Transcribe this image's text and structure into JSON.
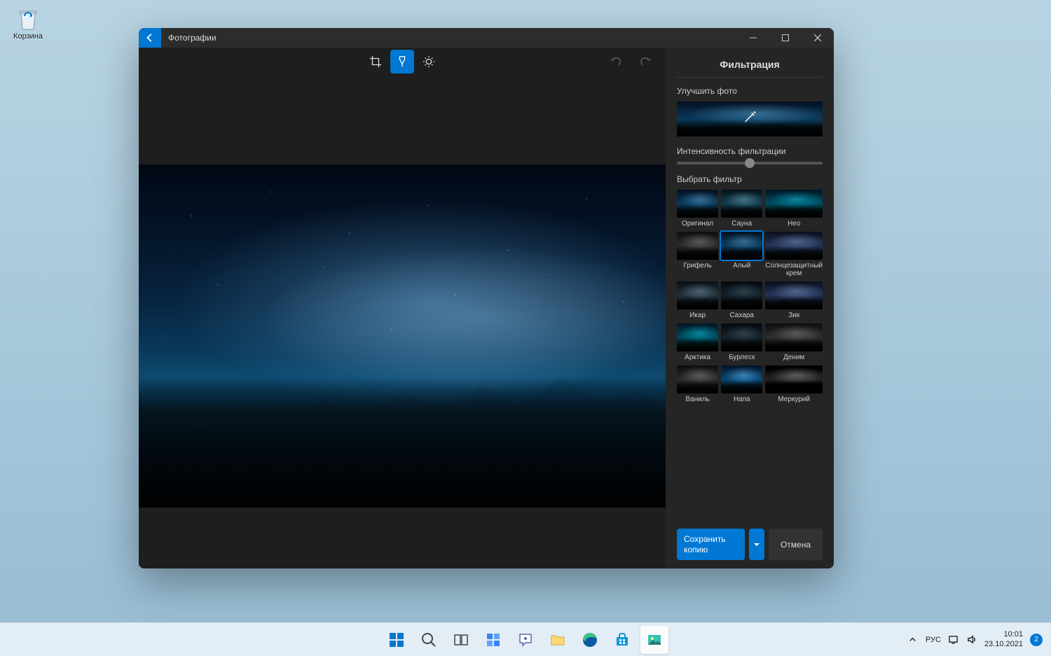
{
  "desktop": {
    "recycle_bin": "Корзина"
  },
  "app": {
    "title": "Фотографии",
    "panel": {
      "title": "Фильтрация",
      "enhance_label": "Улучшить фото",
      "intensity_label": "Интенсивность фильтрации",
      "intensity_value": 50,
      "choose_filter_label": "Выбрать фильтр",
      "filters": [
        {
          "label": "Оригинал",
          "tone": ""
        },
        {
          "label": "Сауна",
          "tone": "f-warm"
        },
        {
          "label": "Нео",
          "tone": "f-blue"
        },
        {
          "label": "Грифель",
          "tone": "f-gray"
        },
        {
          "label": "Алый",
          "tone": ""
        },
        {
          "label": "Солнцезащитный крем",
          "tone": "f-teal"
        },
        {
          "label": "Икар",
          "tone": "f-desat"
        },
        {
          "label": "Сахара",
          "tone": "f-dark"
        },
        {
          "label": "Зик",
          "tone": "f-teal"
        },
        {
          "label": "Арктика",
          "tone": "f-blue"
        },
        {
          "label": "Бурлеск",
          "tone": "f-dark"
        },
        {
          "label": "Деним",
          "tone": "f-gray"
        },
        {
          "label": "Ваниль",
          "tone": "f-gray"
        },
        {
          "label": "Напа",
          "tone": "f-bright"
        },
        {
          "label": "Меркурий",
          "tone": "f-bw"
        }
      ],
      "selected_filter_index": 4,
      "save_label": "Сохранить копию",
      "cancel_label": "Отмена"
    }
  },
  "taskbar": {
    "lang": "РУС",
    "time": "10:01",
    "date": "23.10.2021",
    "notifications": "2"
  }
}
